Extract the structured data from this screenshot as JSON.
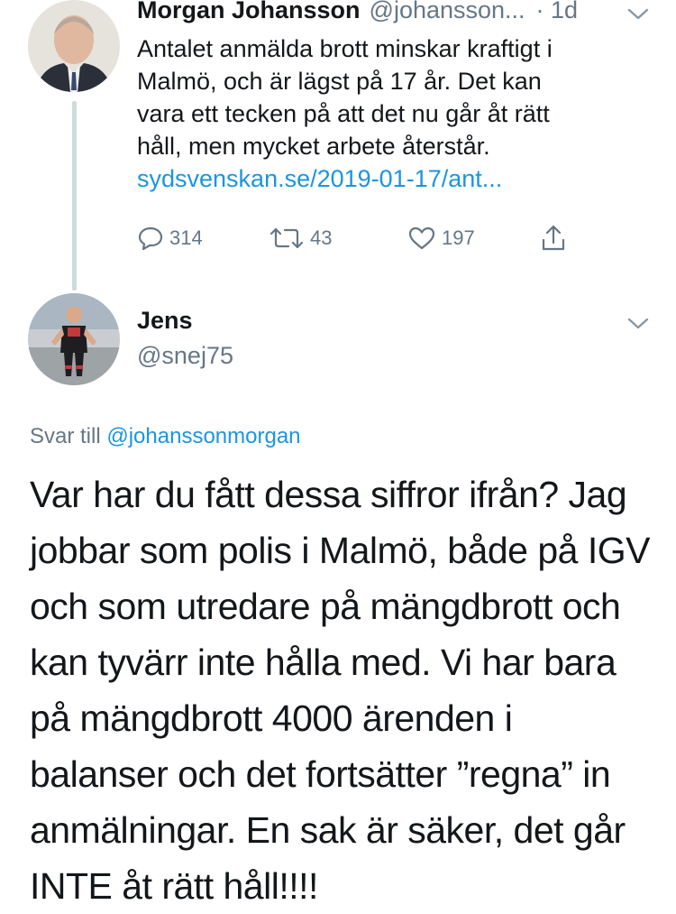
{
  "tweet": {
    "author_name": "Morgan Johansson",
    "author_handle": "@johansson...",
    "time": "· 1d",
    "text_lines": [
      "Antalet anmälda brott minskar kraftigt i",
      "Malmö, och är lägst på 17 år. Det kan",
      "vara ett tecken på att det nu går åt rätt",
      "håll, men mycket arbete återstår."
    ],
    "link": "sydsvenskan.se/2019-01-17/ant...",
    "replies": "314",
    "retweets": "43",
    "likes": "197"
  },
  "reply": {
    "author_name": "Jens",
    "author_handle": "@snej75",
    "reply_prefix": "Svar till",
    "reply_mention": "@johanssonmorgan",
    "text_lines": [
      "Var har du fått dessa siffror ifrån? Jag",
      "jobbar som polis i Malmö, både på IGV",
      "och som utredare på mängdbrott och",
      "kan tyvärr inte hålla med. Vi har bara",
      "på mängdbrott 4000 ärenden i",
      "balanser och det fortsätter ”regna” in",
      "anmälningar. En sak är säker, det går",
      "INTE åt rätt håll!!!!"
    ]
  },
  "colors": {
    "text": "#14171a",
    "secondary": "#657786",
    "link": "#1b95e0",
    "thread_line": "#cfd9de"
  }
}
